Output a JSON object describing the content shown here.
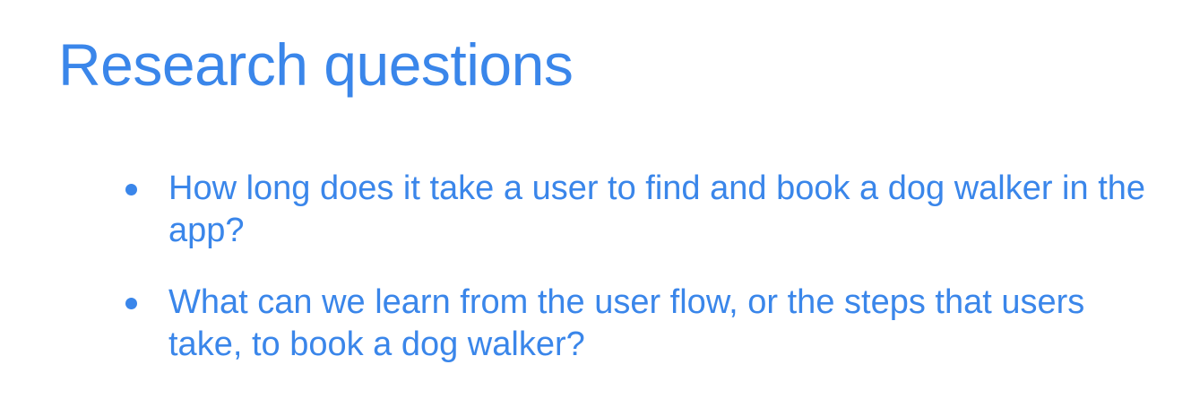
{
  "slide": {
    "title": "Research questions",
    "bullets": [
      {
        "text": "How long does it take a user to find and book a dog walker in the app?"
      },
      {
        "text": "What can we learn from the user flow, or the steps that users take, to book a dog walker?"
      }
    ]
  },
  "colors": {
    "accent": "#3a86ea",
    "background": "#ffffff"
  }
}
